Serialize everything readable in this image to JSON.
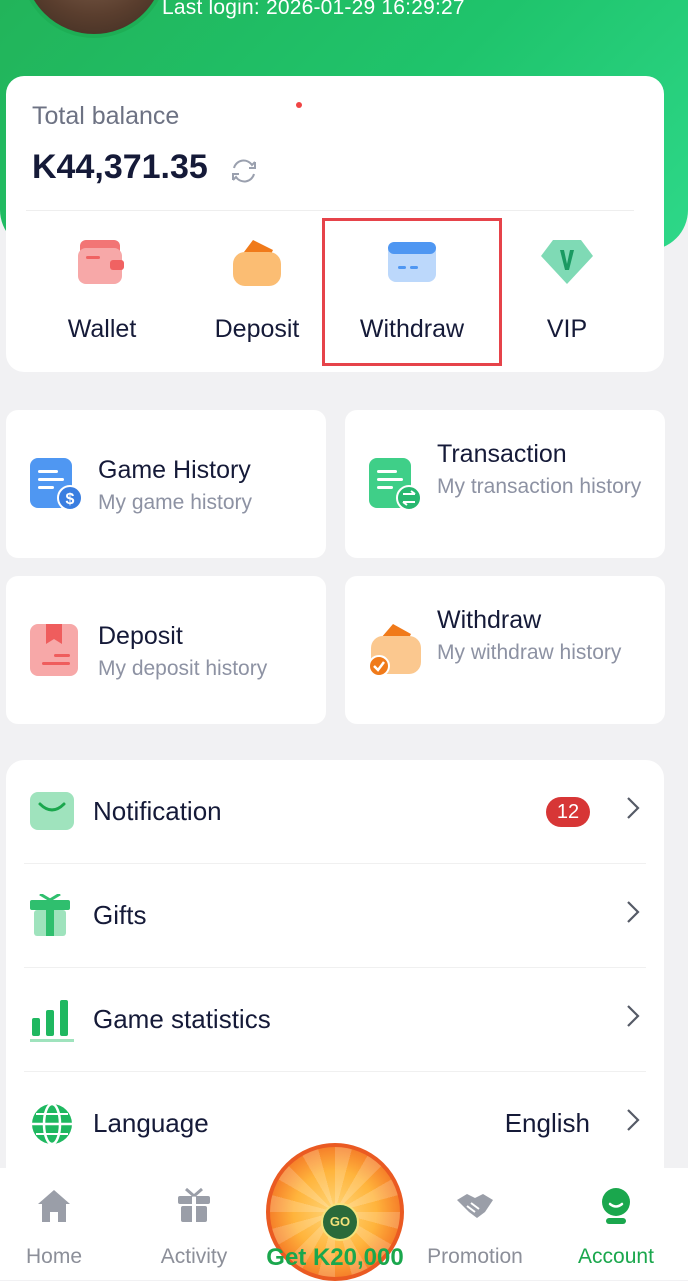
{
  "header": {
    "last_login": "Last login: 2026-01-29 16:29:27"
  },
  "balance": {
    "label": "Total balance",
    "amount": "K44,371.35"
  },
  "actions": [
    {
      "label": "Wallet",
      "icon": "wallet-icon"
    },
    {
      "label": "Deposit",
      "icon": "deposit-icon"
    },
    {
      "label": "Withdraw",
      "icon": "withdraw-card-icon"
    },
    {
      "label": "VIP",
      "icon": "vip-icon"
    }
  ],
  "history_tiles": [
    {
      "title": "Game History",
      "subtitle": "My game history",
      "icon": "game-history-icon"
    },
    {
      "title": "Transaction",
      "subtitle": "My transaction history",
      "icon": "transaction-icon"
    },
    {
      "title": "Deposit",
      "subtitle": "My deposit history",
      "icon": "deposit-history-icon"
    },
    {
      "title": "Withdraw",
      "subtitle": "My withdraw history",
      "icon": "withdraw-history-icon"
    }
  ],
  "menu": [
    {
      "label": "Notification",
      "badge": "12",
      "icon": "notification-icon"
    },
    {
      "label": "Gifts",
      "icon": "gift-icon"
    },
    {
      "label": "Game statistics",
      "icon": "statistics-icon"
    },
    {
      "label": "Language",
      "value": "English",
      "icon": "language-globe-icon"
    }
  ],
  "tabbar": {
    "tabs": [
      {
        "label": "Home",
        "icon": "home-icon"
      },
      {
        "label": "Activity",
        "icon": "activity-gift-icon"
      },
      {
        "label": "Promotion",
        "icon": "handshake-icon"
      },
      {
        "label": "Account",
        "icon": "account-icon",
        "active": true
      }
    ],
    "spin_go": "GO",
    "spin_label": "Get K20,000"
  },
  "colors": {
    "brand_green": "#1fc46c",
    "active_tab": "#1aa74d",
    "badge_red": "#d73636",
    "highlight_red": "#e6434a"
  }
}
